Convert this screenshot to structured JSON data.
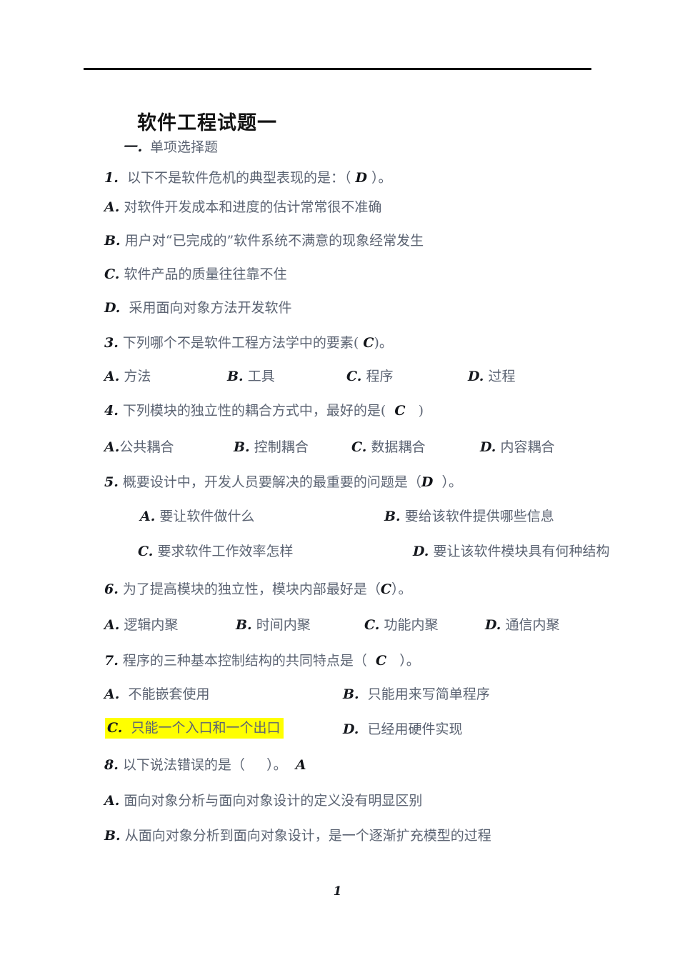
{
  "document": {
    "title": "软件工程试题一",
    "section_label": "一．",
    "section_title": "单项选择题",
    "page_number": "1"
  },
  "questions": [
    {
      "number": "1.",
      "stem_before": "以下不是软件危机的典型表现的是：（",
      "answer": "D",
      "stem_after": "）。",
      "options": [
        {
          "label": "A.",
          "text": "对软件开发成本和进度的估计常常很不准确"
        },
        {
          "label": "B.",
          "text": "用户对“已完成的”软件系统不满意的现象经常发生"
        },
        {
          "label": "C.",
          "text": "软件产品的质量往往靠不住"
        },
        {
          "label": "D.",
          "text": "采用面向对象方法开发软件"
        }
      ]
    },
    {
      "number": "3.",
      "stem_before": "下列哪个不是软件工程方法学中的要素(",
      "answer": "C",
      "stem_after": ")。",
      "options": [
        {
          "label": "A.",
          "text": "方法"
        },
        {
          "label": "B.",
          "text": "工具"
        },
        {
          "label": "C.",
          "text": "程序"
        },
        {
          "label": "D.",
          "text": "过程"
        }
      ]
    },
    {
      "number": "4.",
      "stem_before": "下列模块的独立性的耦合方式中，最好的是(",
      "answer": "C",
      "stem_after": ")",
      "options": [
        {
          "label": "A.",
          "text": "公共耦合"
        },
        {
          "label": "B.",
          "text": "控制耦合"
        },
        {
          "label": "C.",
          "text": "数据耦合"
        },
        {
          "label": "D.",
          "text": "内容耦合"
        }
      ]
    },
    {
      "number": "5.",
      "stem_before": "概要设计中，开发人员要解决的最重要的问题是（",
      "answer": "D",
      "stem_after": "）。",
      "options": [
        {
          "label": "A.",
          "text": "要让软件做什么"
        },
        {
          "label": "B.",
          "text": "要给该软件提供哪些信息"
        },
        {
          "label": "C.",
          "text": "要求软件工作效率怎样"
        },
        {
          "label": "D.",
          "text": "要让该软件模块具有何种结构"
        }
      ]
    },
    {
      "number": "6.",
      "stem_before": "为了提高模块的独立性，模块内部最好是（",
      "answer": "C",
      "stem_after": "）。",
      "options": [
        {
          "label": "A.",
          "text": "逻辑内聚"
        },
        {
          "label": "B.",
          "text": "时间内聚"
        },
        {
          "label": "C.",
          "text": "功能内聚"
        },
        {
          "label": "D.",
          "text": "通信内聚"
        }
      ]
    },
    {
      "number": "7.",
      "stem_before": "程序的三种基本控制结构的共同特点是（",
      "answer": "C",
      "stem_after": "）。",
      "options": [
        {
          "label": "A.",
          "text": "不能嵌套使用"
        },
        {
          "label": "B.",
          "text": "只能用来写简单程序"
        },
        {
          "label": "C.",
          "text": "只能一个入口和一个出口",
          "highlighted": true
        },
        {
          "label": "D.",
          "text": "已经用硬件实现"
        }
      ]
    },
    {
      "number": "8.",
      "stem_before": "以下说法错误的是（",
      "stem_after": "）。",
      "answer_after": "A",
      "options": [
        {
          "label": "A.",
          "text": "面向对象分析与面向对象设计的定义没有明显区别"
        },
        {
          "label": "B.",
          "text": "从面向对象分析到面向对象设计，是一个逐渐扩充模型的过程"
        }
      ]
    }
  ],
  "colors": {
    "highlight": "#ffff00",
    "body_text": "#5c6473",
    "label_text": "#15181e",
    "rule": "#000000"
  }
}
